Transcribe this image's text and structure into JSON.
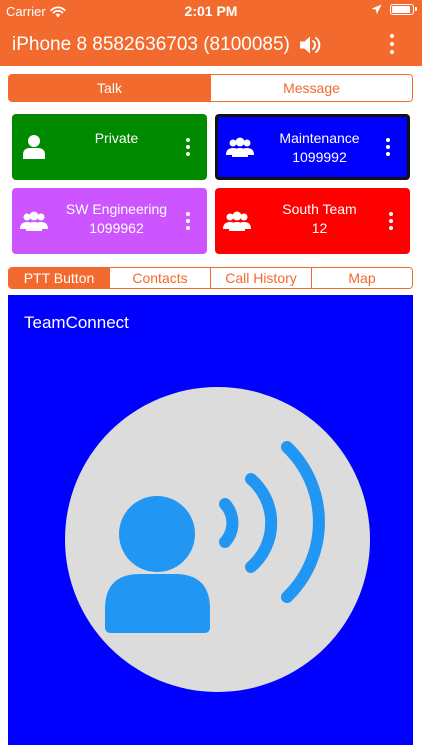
{
  "status_bar": {
    "carrier": "Carrier",
    "time": "2:01 PM",
    "battery_level": 0.9
  },
  "header": {
    "title": "iPhone 8 8582636703 (8100085)"
  },
  "mode_tabs": [
    {
      "label": "Talk",
      "active": true
    },
    {
      "label": "Message",
      "active": false
    }
  ],
  "groups": [
    {
      "name": "Private",
      "id": "",
      "color": "#008a00",
      "icon": "single-user-icon",
      "selected": false
    },
    {
      "name": "Maintenance",
      "id": "1099992",
      "color": "#0000ff",
      "icon": "group-icon",
      "selected": true
    },
    {
      "name": "SW Engineering",
      "id": "1099962",
      "color": "#cc55ff",
      "icon": "group-icon",
      "selected": false
    },
    {
      "name": "South Team",
      "id": "12",
      "color": "#ff0000",
      "icon": "group-icon",
      "selected": false
    }
  ],
  "view_tabs": [
    {
      "label": "PTT Button",
      "active": true
    },
    {
      "label": "Contacts",
      "active": false
    },
    {
      "label": "Call History",
      "active": false
    },
    {
      "label": "Map",
      "active": false
    }
  ],
  "ptt": {
    "label": "TeamConnect",
    "background": "#0000ff",
    "icon_color": "#2196f3"
  }
}
